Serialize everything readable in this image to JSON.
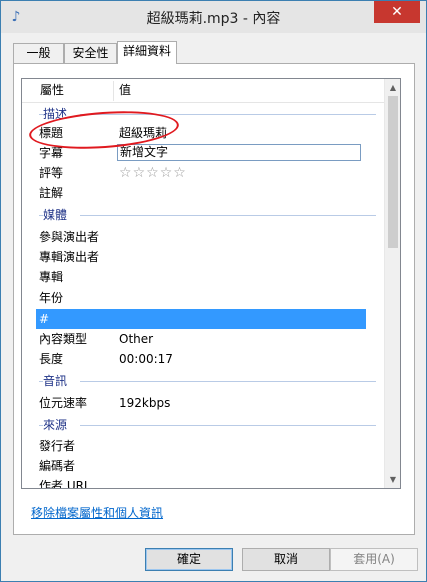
{
  "window": {
    "title": "超級瑪莉.mp3 - 內容",
    "close_label": "✕",
    "app_icon": "music-note-icon"
  },
  "tabs": [
    {
      "label": "一般",
      "active": false
    },
    {
      "label": "安全性",
      "active": false
    },
    {
      "label": "詳細資料",
      "active": true
    }
  ],
  "listview": {
    "header": {
      "property": "屬性",
      "value": "值"
    },
    "groups": {
      "description": "描述",
      "media": "媒體",
      "audio": "音訊",
      "origin": "來源"
    },
    "rows": {
      "title": {
        "property": "標題",
        "value": "超級瑪莉"
      },
      "subtitle": {
        "property": "字幕",
        "placeholder": "新增文字"
      },
      "rating": {
        "property": "評等",
        "stars": 5
      },
      "comments": {
        "property": "註解",
        "value": ""
      },
      "contributing_artists": {
        "property": "參與演出者",
        "value": ""
      },
      "album_artist": {
        "property": "專輯演出者",
        "value": ""
      },
      "album": {
        "property": "專輯",
        "value": ""
      },
      "year": {
        "property": "年份",
        "value": ""
      },
      "track_number": {
        "property": "#",
        "value": ""
      },
      "genre": {
        "property": "內容類型",
        "value": "Other"
      },
      "length": {
        "property": "長度",
        "value": "00:00:17"
      },
      "bit_rate": {
        "property": "位元速率",
        "value": "192kbps"
      },
      "publisher": {
        "property": "發行者",
        "value": ""
      },
      "encoded_by": {
        "property": "編碼者",
        "value": ""
      },
      "author_url": {
        "property": "作者 URL",
        "value": ""
      }
    },
    "scrollbar": {
      "up_icon": "arrow-up-icon",
      "down_icon": "arrow-down-icon"
    }
  },
  "remove_properties_link": "移除檔案屬性和個人資訊",
  "buttons": {
    "ok": "確定",
    "cancel": "取消",
    "apply": "套用(A)"
  },
  "colors": {
    "selection": "#3399ff",
    "annotation": "#e0191f",
    "group_header": "#1e3287",
    "link": "#0066cc"
  }
}
